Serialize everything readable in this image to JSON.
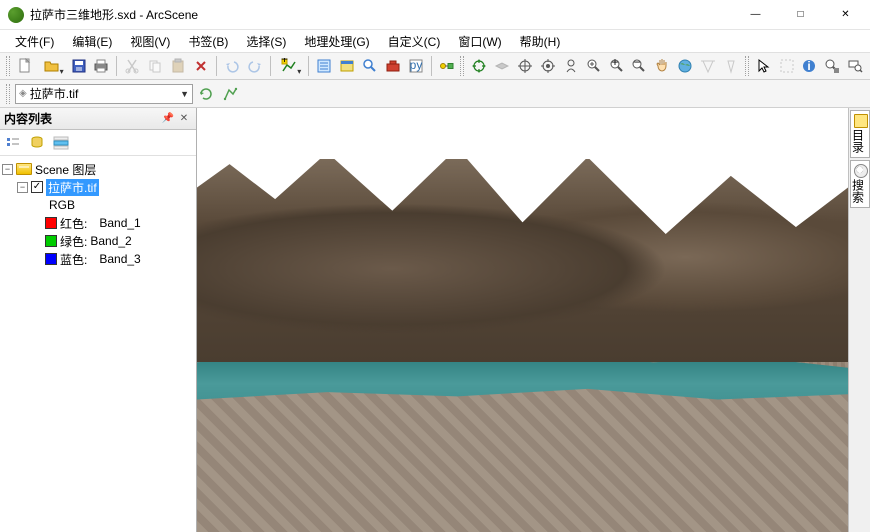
{
  "window": {
    "title": "拉萨市三维地形.sxd - ArcScene",
    "min": "—",
    "max": "□",
    "close": "✕"
  },
  "menus": [
    "文件(F)",
    "编辑(E)",
    "视图(V)",
    "书签(B)",
    "选择(S)",
    "地理处理(G)",
    "自定义(C)",
    "窗口(W)",
    "帮助(H)"
  ],
  "layer_selector": "拉萨市.tif",
  "toc": {
    "title": "内容列表",
    "scene_label": "Scene 图层",
    "layer": "拉萨市.tif",
    "rgb_label": "RGB",
    "bands": [
      {
        "color": "red",
        "label": "红色:",
        "band": "Band_1"
      },
      {
        "color": "green",
        "label": "绿色:",
        "band": "Band_2"
      },
      {
        "color": "blue",
        "label": "蓝色:",
        "band": "Band_3"
      }
    ]
  },
  "rail": {
    "catalog": "目录",
    "search": "搜索"
  }
}
